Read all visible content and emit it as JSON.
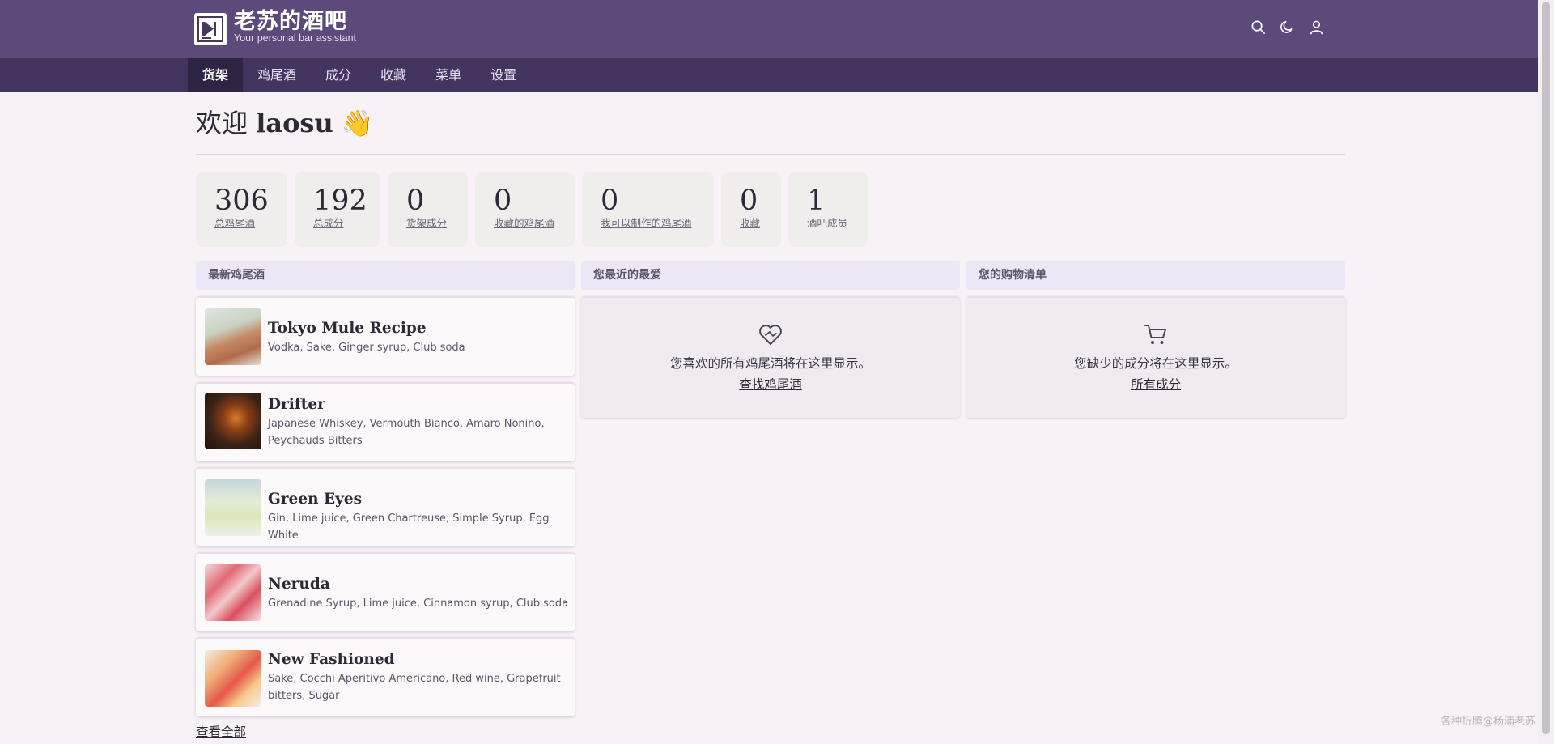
{
  "brand": {
    "title": "老苏的酒吧",
    "subtitle": "Your personal bar assistant",
    "header_color": "#5b4a7a",
    "nav_color": "#443460"
  },
  "header_icons": [
    "search-icon",
    "moon-icon",
    "user-icon"
  ],
  "nav": {
    "tabs": [
      {
        "label": "货架",
        "active": true
      },
      {
        "label": "鸡尾酒",
        "active": false
      },
      {
        "label": "成分",
        "active": false
      },
      {
        "label": "收藏",
        "active": false
      },
      {
        "label": "菜单",
        "active": false
      },
      {
        "label": "设置",
        "active": false
      }
    ]
  },
  "welcome": {
    "prefix": "欢迎",
    "username": "laosu",
    "emoji": "👋"
  },
  "stats": [
    {
      "value": "306",
      "label": "总鸡尾酒"
    },
    {
      "value": "192",
      "label": "总成分"
    },
    {
      "value": "0",
      "label": "货架成分"
    },
    {
      "value": "0",
      "label": "收藏的鸡尾酒"
    },
    {
      "value": "0",
      "label": "我可以制作的鸡尾酒"
    },
    {
      "value": "0",
      "label": "收藏"
    },
    {
      "value": "1",
      "label": "酒吧成员"
    }
  ],
  "latest": {
    "heading": "最新鸡尾酒",
    "items": [
      {
        "name": "Tokyo Mule Recipe",
        "ingredients": "Vodka, Sake, Ginger syrup, Club soda"
      },
      {
        "name": "Drifter",
        "ingredients": "Japanese Whiskey, Vermouth Bianco, Amaro Nonino, Peychauds Bitters"
      },
      {
        "name": "Green Eyes",
        "ingredients": "Gin, Lime juice, Green Chartreuse, Simple Syrup, Egg White"
      },
      {
        "name": "Neruda",
        "ingredients": "Grenadine Syrup, Lime juice, Cinnamon syrup, Club soda"
      },
      {
        "name": "New Fashioned",
        "ingredients": "Sake, Cocchi Aperitivo Americano, Red wine, Grapefruit bitters, Sugar"
      }
    ],
    "view_all": "查看全部"
  },
  "favorites": {
    "heading": "您最近的最爱",
    "icon": "heart-icon",
    "empty_text": "您喜欢的所有鸡尾酒将在这里显示。",
    "link": "查找鸡尾酒"
  },
  "shopping": {
    "heading": "您的购物清单",
    "icon": "cart-icon",
    "empty_text": "您缺少的成分将在这里显示。",
    "link": "所有成分"
  },
  "watermark": "各种折腾@杨浦老苏"
}
